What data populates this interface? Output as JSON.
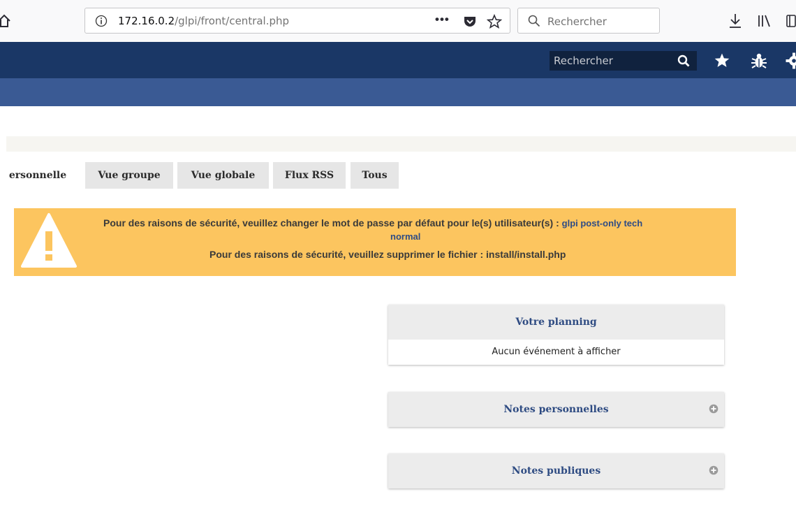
{
  "browser": {
    "url_host": "172.16.0.2",
    "url_path": "/glpi/front/central.php",
    "more_label": "•••",
    "search_placeholder": "Rechercher"
  },
  "header": {
    "search_placeholder": "Rechercher",
    "colors": {
      "top": "#1a3766",
      "sub": "#3a5a94"
    }
  },
  "tabs": [
    {
      "label": "ersonnelle",
      "active": true
    },
    {
      "label": "Vue groupe"
    },
    {
      "label": "Vue globale"
    },
    {
      "label": "Flux RSS"
    },
    {
      "label": "Tous"
    }
  ],
  "warning": {
    "line1_prefix": "Pour des raisons de sécurité, veuillez changer le mot de passe par défaut pour le(s) utilisateur(s) :",
    "line1_users": "glpi post-only tech",
    "line1_users_cont": "normal",
    "line2": "Pour des raisons de sécurité, veuillez supprimer le fichier : install/install.php",
    "color": "#fcc55f"
  },
  "panels": {
    "planning": {
      "title": "Votre planning",
      "body": "Aucun événement à afficher"
    },
    "personal_notes": {
      "title": "Notes personnelles"
    },
    "public_notes": {
      "title": "Notes publiques"
    }
  }
}
